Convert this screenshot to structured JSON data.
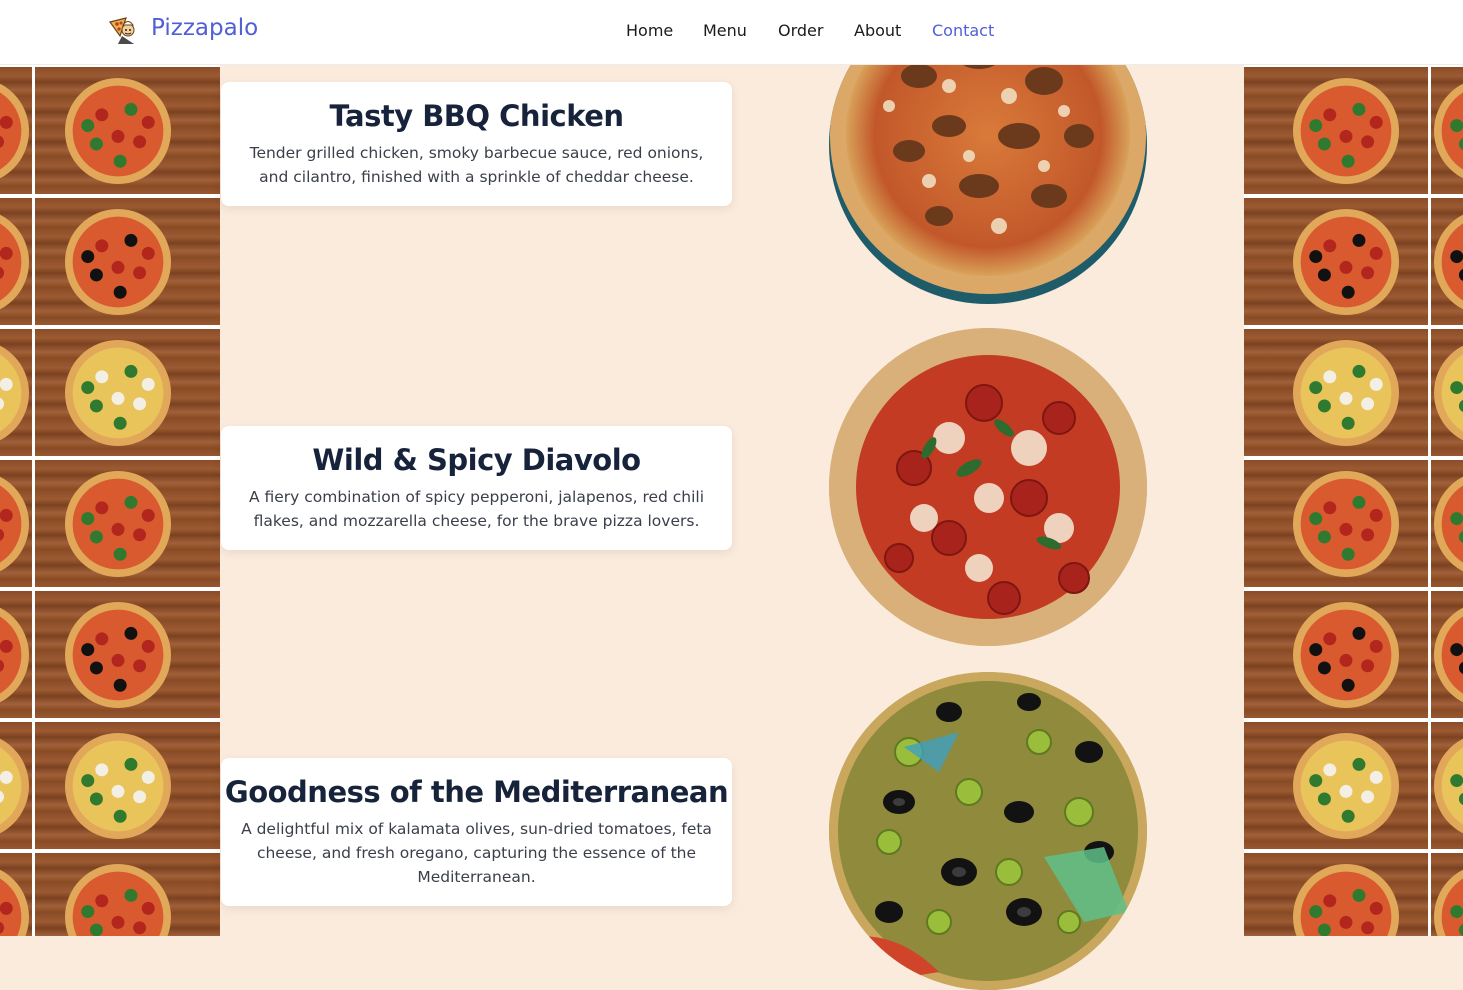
{
  "brand": {
    "name": "Pizzapalo",
    "logo_icon": "pizza-chef-logo-icon"
  },
  "nav": {
    "items": [
      {
        "label": "Home",
        "active": false
      },
      {
        "label": "Menu",
        "active": false
      },
      {
        "label": "Order",
        "active": false
      },
      {
        "label": "About",
        "active": false
      },
      {
        "label": "Contact",
        "active": true
      }
    ]
  },
  "colors": {
    "accent": "#4f5fd7",
    "page_background": "#fbebdc",
    "card_title": "#17233a",
    "card_text": "#3a3f4a"
  },
  "pizzas": [
    {
      "title": "Tasty BBQ Chicken",
      "description": "Tender grilled chicken, smoky barbecue sauce, red onions, and cilantro, finished with a sprinkle of cheddar cheese.",
      "image_icon": "bbq-chicken-pizza-image"
    },
    {
      "title": "Wild & Spicy Diavolo",
      "description": "A fiery combination of spicy pepperoni, jalapenos, red chili flakes, and mozzarella cheese, for the brave pizza lovers.",
      "image_icon": "diavolo-pizza-image"
    },
    {
      "title": "Goodness of the Mediterranean",
      "description": "A delightful mix of kalamata olives, sun-dried tomatoes, feta cheese, and fresh oregano, capturing the essence of the Mediterranean.",
      "image_icon": "mediterranean-pizza-image"
    }
  ]
}
